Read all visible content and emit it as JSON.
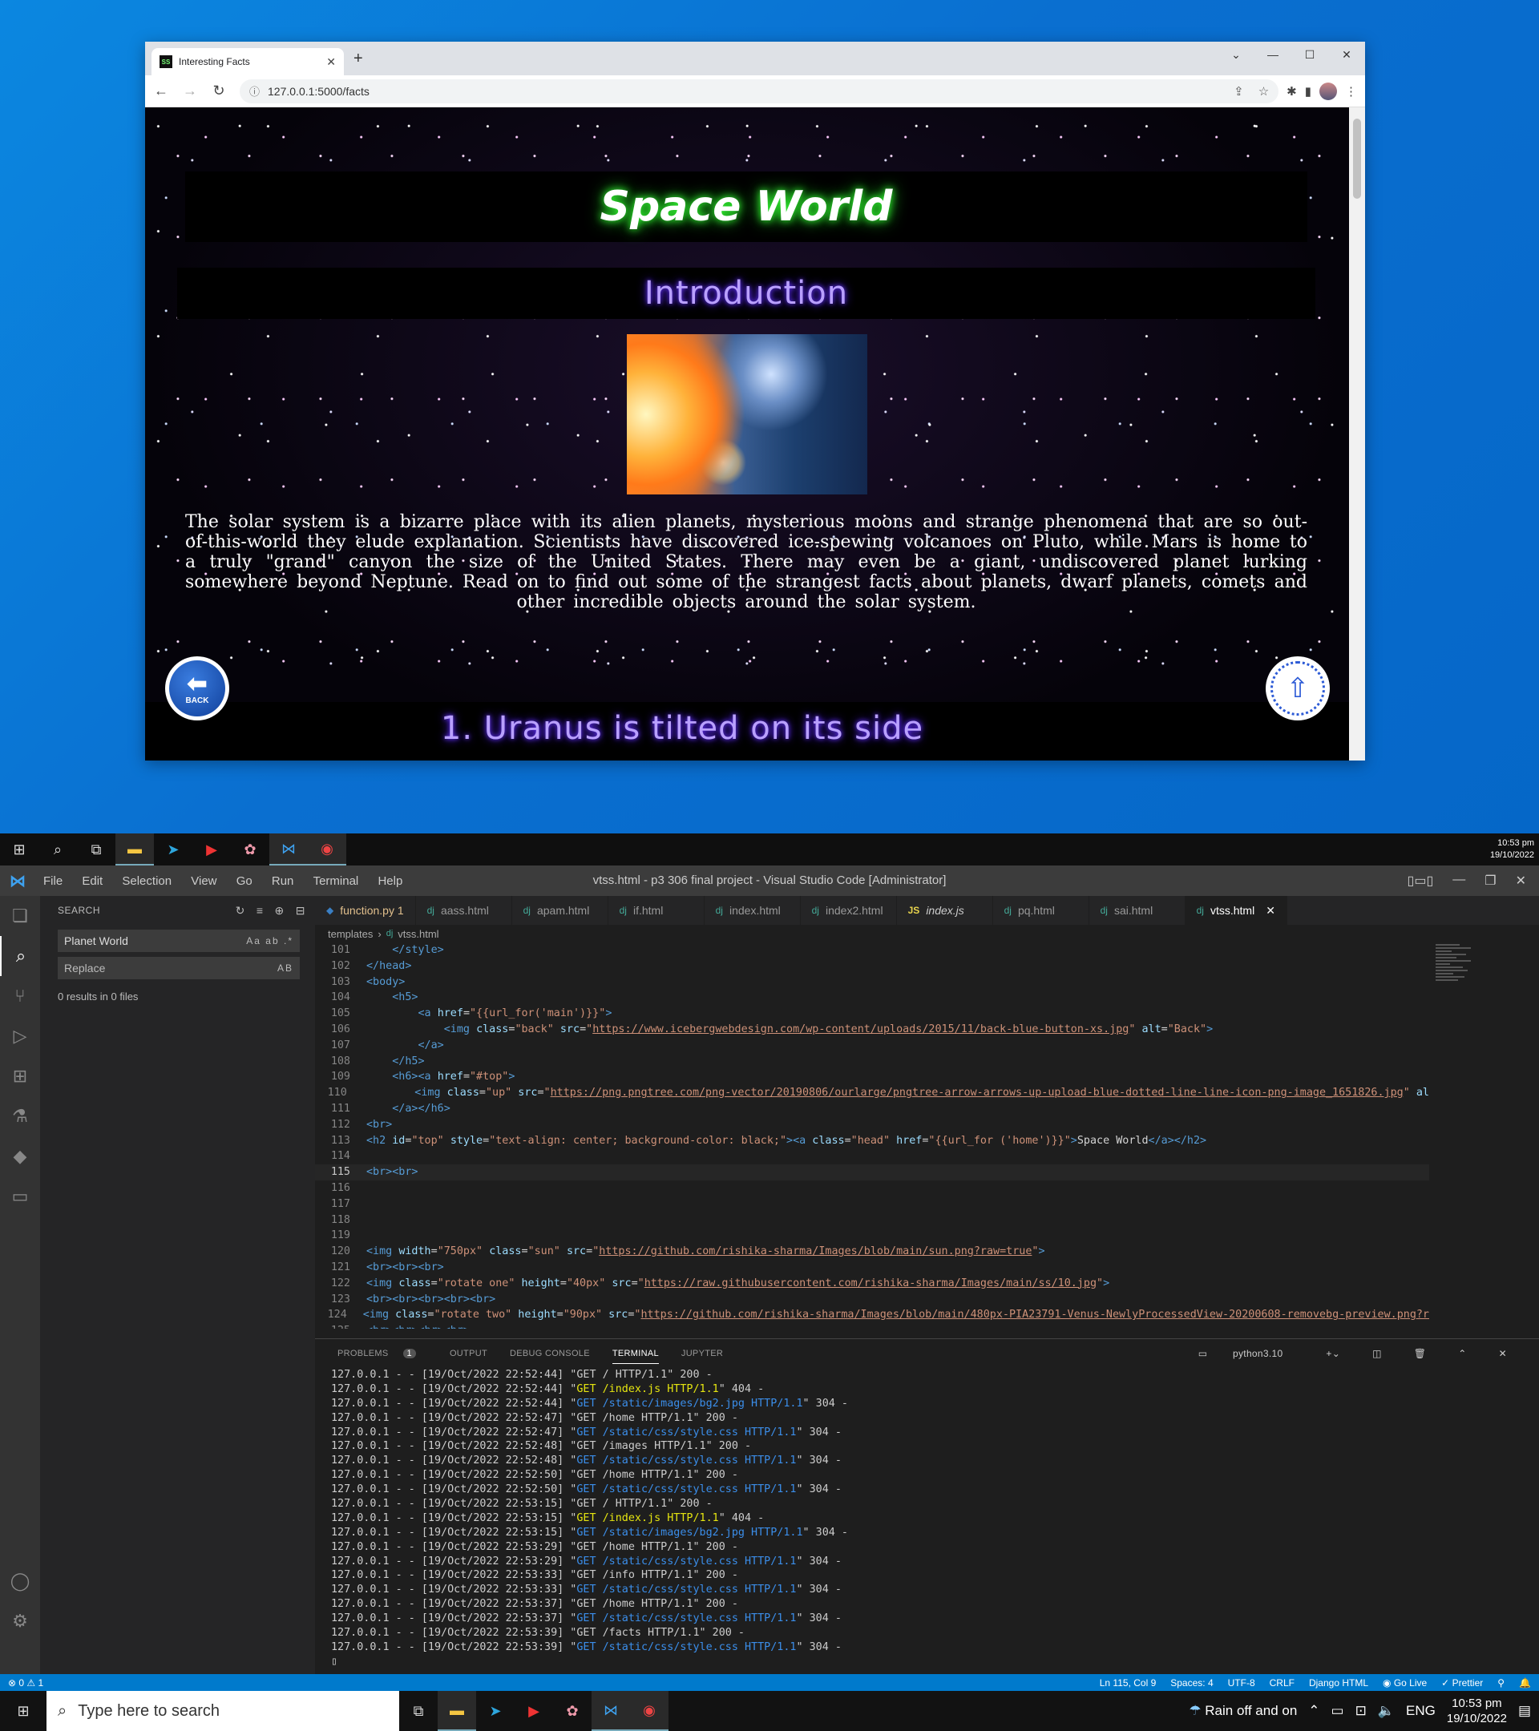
{
  "browser": {
    "tab_title": "Interesting Facts",
    "favicon_text": "SS",
    "url": "127.0.0.1:5000/facts"
  },
  "page": {
    "site_title": "Space World",
    "intro_heading": "Introduction",
    "intro_text": "The solar system is a bizarre place with its alien planets, mysterious moons and strange phenomena that are so out-of-this-world they elude explanation. Scientists have discovered ice-spewing volcanoes on Pluto, while Mars is home to a truly \"grand\" canyon the size of the United States. There may even be a giant, undiscovered planet lurking somewhere beyond Neptune. Read on to find out some of the strangest facts about planets, dwarf planets, comets and other incredible objects around the solar system.",
    "back_label": "BACK",
    "fact_title": "1. Uranus is tilted on its side"
  },
  "taskbar_top": {
    "time": "10:53 pm",
    "date": "19/10/2022"
  },
  "vscode": {
    "menu": [
      "File",
      "Edit",
      "Selection",
      "View",
      "Go",
      "Run",
      "Terminal",
      "Help"
    ],
    "window_title": "vtss.html - p3 306 final project - Visual Studio Code [Administrator]",
    "search": {
      "header": "SEARCH",
      "query": "Planet World",
      "replace_placeholder": "Replace",
      "results": "0 results in 0 files"
    },
    "tabs": [
      "function.py 1",
      "aass.html",
      "apam.html",
      "if.html",
      "index.html",
      "index2.html",
      "index.js",
      "pq.html",
      "sai.html",
      "vtss.html"
    ],
    "breadcrumb": {
      "folder": "templates",
      "file": "vtss.html"
    },
    "panel_tabs": {
      "problems": "PROBLEMS",
      "problems_count": "1",
      "output": "OUTPUT",
      "debug": "DEBUG CONSOLE",
      "terminal": "TERMINAL",
      "jupyter": "JUPYTER",
      "shell": "python3.10"
    },
    "terminal_lines": [
      [
        "127.0.0.1 - - [19/Oct/2022 22:52:44] \"GET / HTTP/1.1\" 200 -",
        "n"
      ],
      [
        "127.0.0.1 - - [19/Oct/2022 22:52:44] \"GET /index.js HTTP/1.1\" 404 -",
        "y"
      ],
      [
        "127.0.0.1 - - [19/Oct/2022 22:52:44] \"GET /static/images/bg2.jpg HTTP/1.1\" 304 -",
        "b"
      ],
      [
        "127.0.0.1 - - [19/Oct/2022 22:52:47] \"GET /home HTTP/1.1\" 200 -",
        "n"
      ],
      [
        "127.0.0.1 - - [19/Oct/2022 22:52:47] \"GET /static/css/style.css HTTP/1.1\" 304 -",
        "b"
      ],
      [
        "127.0.0.1 - - [19/Oct/2022 22:52:48] \"GET /images HTTP/1.1\" 200 -",
        "n"
      ],
      [
        "127.0.0.1 - - [19/Oct/2022 22:52:48] \"GET /static/css/style.css HTTP/1.1\" 304 -",
        "b"
      ],
      [
        "127.0.0.1 - - [19/Oct/2022 22:52:50] \"GET /home HTTP/1.1\" 200 -",
        "n"
      ],
      [
        "127.0.0.1 - - [19/Oct/2022 22:52:50] \"GET /static/css/style.css HTTP/1.1\" 304 -",
        "b"
      ],
      [
        "127.0.0.1 - - [19/Oct/2022 22:53:15] \"GET / HTTP/1.1\" 200 -",
        "n"
      ],
      [
        "127.0.0.1 - - [19/Oct/2022 22:53:15] \"GET /index.js HTTP/1.1\" 404 -",
        "y"
      ],
      [
        "127.0.0.1 - - [19/Oct/2022 22:53:15] \"GET /static/images/bg2.jpg HTTP/1.1\" 304 -",
        "b"
      ],
      [
        "127.0.0.1 - - [19/Oct/2022 22:53:29] \"GET /home HTTP/1.1\" 200 -",
        "n"
      ],
      [
        "127.0.0.1 - - [19/Oct/2022 22:53:29] \"GET /static/css/style.css HTTP/1.1\" 304 -",
        "b"
      ],
      [
        "127.0.0.1 - - [19/Oct/2022 22:53:33] \"GET /info HTTP/1.1\" 200 -",
        "n"
      ],
      [
        "127.0.0.1 - - [19/Oct/2022 22:53:33] \"GET /static/css/style.css HTTP/1.1\" 304 -",
        "b"
      ],
      [
        "127.0.0.1 - - [19/Oct/2022 22:53:37] \"GET /home HTTP/1.1\" 200 -",
        "n"
      ],
      [
        "127.0.0.1 - - [19/Oct/2022 22:53:37] \"GET /static/css/style.css HTTP/1.1\" 304 -",
        "b"
      ],
      [
        "127.0.0.1 - - [19/Oct/2022 22:53:39] \"GET /facts HTTP/1.1\" 200 -",
        "n"
      ],
      [
        "127.0.0.1 - - [19/Oct/2022 22:53:39] \"GET /static/css/style.css HTTP/1.1\" 304 -",
        "b"
      ]
    ],
    "status": {
      "errors": "⊗ 0 ⚠ 1",
      "position": "Ln 115, Col 9",
      "spaces": "Spaces: 4",
      "encoding": "UTF-8",
      "eol": "CRLF",
      "language": "Django HTML",
      "golive": "Go Live",
      "prettier": "Prettier"
    }
  },
  "taskbar_bottom": {
    "search_placeholder": "Type here to search",
    "weather": "Rain off and on",
    "lang": "ENG",
    "time": "10:53 pm",
    "date": "19/10/2022"
  },
  "colors": {
    "accent": "#007acc",
    "title_glow": "#33ff33",
    "heading_glow": "#6633ff"
  }
}
